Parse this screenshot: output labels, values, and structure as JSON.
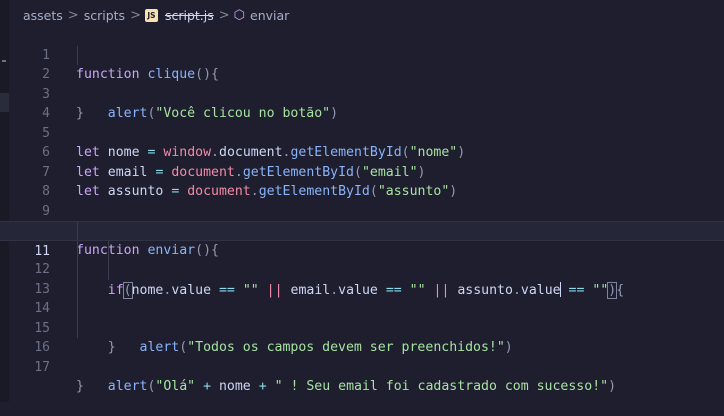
{
  "breadcrumb": {
    "folder1": "assets",
    "folder2": "scripts",
    "file_badge": "JS",
    "file": "script.js",
    "symbol": "enviar",
    "separator": ">"
  },
  "editor": {
    "current_line": 11,
    "lines": [
      {
        "n": "1"
      },
      {
        "n": "2"
      },
      {
        "n": "3"
      },
      {
        "n": "4"
      },
      {
        "n": "5"
      },
      {
        "n": "6"
      },
      {
        "n": "7"
      },
      {
        "n": "8"
      },
      {
        "n": "9"
      },
      {
        "n": "10"
      },
      {
        "n": "11"
      },
      {
        "n": "12"
      },
      {
        "n": "13"
      },
      {
        "n": "14"
      },
      {
        "n": "15"
      },
      {
        "n": "16"
      },
      {
        "n": "17"
      }
    ]
  },
  "tokens": {
    "function_kw": "function",
    "let_kw": "let",
    "if_kw": "if",
    "clique": "clique",
    "enviar": "enviar",
    "alert": "alert",
    "window": "window",
    "document": "document",
    "getElementById": "getElementById",
    "nome": "nome",
    "email": "email",
    "assunto": "assunto",
    "value": "value",
    "str_clicou": "\"Você clicou no botão\"",
    "str_nome": "\"nome\"",
    "str_email": "\"email\"",
    "str_assunto": "\"assunto\"",
    "str_empty": "\"\"",
    "str_todos": "\"Todos os campos devem ser preenchidos!\"",
    "str_ola": "\"Olá\"",
    "str_sucesso": "\" ! Seu email foi cadastrado com sucesso!\"",
    "eq": "=",
    "eqeq": "==",
    "oror": "||",
    "plus": "+"
  },
  "colors": {
    "background": "#1e1e2e",
    "keyword": "#cba6f7",
    "function": "#89b4fa",
    "string": "#a6e3a1",
    "operator": "#89dceb"
  }
}
